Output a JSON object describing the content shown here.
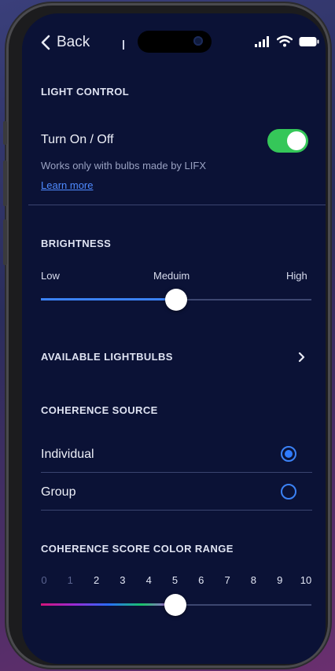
{
  "status_bar": {
    "back_label": "Back",
    "icons": [
      "signal-icon",
      "wifi-icon",
      "battery-icon"
    ]
  },
  "light_control": {
    "title": "LIGHT CONTROL",
    "toggle_label": "Turn On / Off",
    "toggle_on": true,
    "note": "Works only with bulbs made by LIFX",
    "learn_more": "Learn more"
  },
  "brightness": {
    "title": "BRIGHTNESS",
    "low_label": "Low",
    "mid_label": "Meduim",
    "high_label": "High",
    "value_fraction": 0.5
  },
  "lightbulbs": {
    "title": "AVAILABLE LIGHTBULBS"
  },
  "coherence_source": {
    "title": "COHERENCE SOURCE",
    "options": [
      {
        "label": "Individual",
        "selected": true
      },
      {
        "label": "Group",
        "selected": false
      }
    ]
  },
  "color_range": {
    "title": "COHERENCE SCORE COLOR RANGE",
    "scale": [
      "0",
      "1",
      "2",
      "3",
      "4",
      "5",
      "6",
      "7",
      "8",
      "9",
      "10"
    ],
    "value": 5
  },
  "colors": {
    "background": "#0b1236",
    "toggle_on": "#35c759",
    "accent": "#2f7bff",
    "link": "#4f8bff"
  }
}
